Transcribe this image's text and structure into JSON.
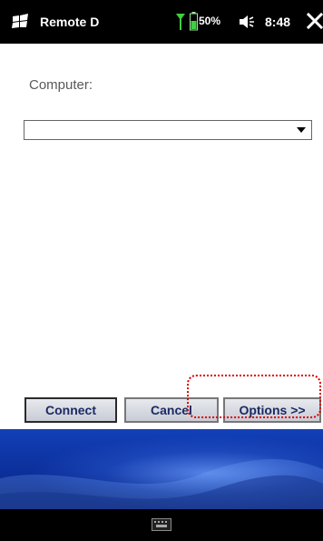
{
  "status_bar": {
    "app_title": "Remote D",
    "battery": "50%",
    "time": "8:48"
  },
  "form": {
    "computer_label": "Computer:",
    "computer_value": ""
  },
  "buttons": {
    "connect": "Connect",
    "cancel": "Cancel",
    "options": "Options >>"
  },
  "colors": {
    "button_text": "#1b2a63",
    "highlight": "#e00000",
    "wallpaper": "#0c2f9a"
  },
  "icons": {
    "start": "windows-flag-icon",
    "signal": "signal-icon",
    "battery": "battery-icon",
    "volume": "volume-icon",
    "close": "close-icon",
    "keyboard": "keyboard-icon"
  }
}
